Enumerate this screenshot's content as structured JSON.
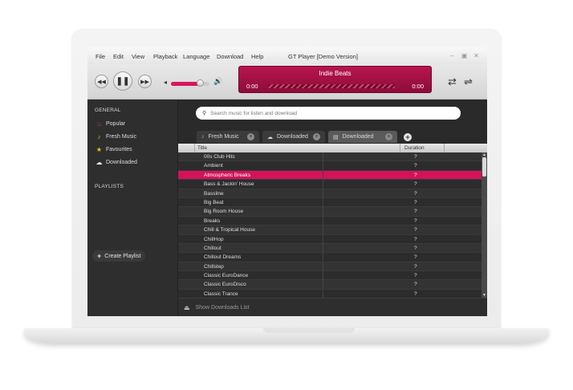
{
  "window": {
    "title": "GT Player [Demo Version]",
    "menu": [
      "File",
      "Edit",
      "View",
      "Playback",
      "Language",
      "Download",
      "Help"
    ]
  },
  "player": {
    "track": "Indie Beats",
    "time_elapsed": "0:00",
    "time_total": "0:00",
    "volume_level": 0.75,
    "accent_color": "#d4125a"
  },
  "sidebar": {
    "general_heading": "GENERAL",
    "items": [
      {
        "label": "Popular",
        "icon": "flame-icon"
      },
      {
        "label": "Fresh Music",
        "icon": "music-note-icon"
      },
      {
        "label": "Favourites",
        "icon": "star-icon"
      },
      {
        "label": "Downloaded",
        "icon": "cloud-download-icon"
      }
    ],
    "playlists_heading": "PLAYLISTS",
    "create_playlist": "Create Playlist"
  },
  "search": {
    "placeholder": "Search music for listen and download"
  },
  "tabs": [
    {
      "label": "Fresh Music",
      "icon": "music-note-icon"
    },
    {
      "label": "Downloaded",
      "icon": "cloud-download-icon"
    },
    {
      "label": "Downloaded",
      "icon": "drive-icon"
    }
  ],
  "table": {
    "columns": [
      "Title",
      "Duration"
    ],
    "rows": [
      {
        "title": "00s Club Hits",
        "duration": "?"
      },
      {
        "title": "Ambient",
        "duration": "?"
      },
      {
        "title": "Atmospheric Breaks",
        "duration": "?",
        "selected": true
      },
      {
        "title": "Bass & Jackin' House",
        "duration": "?"
      },
      {
        "title": "Bassline",
        "duration": "?"
      },
      {
        "title": "Big Beat",
        "duration": "?"
      },
      {
        "title": "Big Room House",
        "duration": "?"
      },
      {
        "title": "Breaks",
        "duration": "?"
      },
      {
        "title": "Chill & Tropical House",
        "duration": "?"
      },
      {
        "title": "ChillHop",
        "duration": "?"
      },
      {
        "title": "Chillout",
        "duration": "?"
      },
      {
        "title": "Chillout Dreams",
        "duration": "?"
      },
      {
        "title": "Chillstep",
        "duration": "?"
      },
      {
        "title": "Classic EuroDance",
        "duration": "?"
      },
      {
        "title": "Classic EuroDisco",
        "duration": "?"
      },
      {
        "title": "Classic Trance",
        "duration": "?"
      }
    ]
  },
  "footer": {
    "label": "Show Downloads List"
  }
}
